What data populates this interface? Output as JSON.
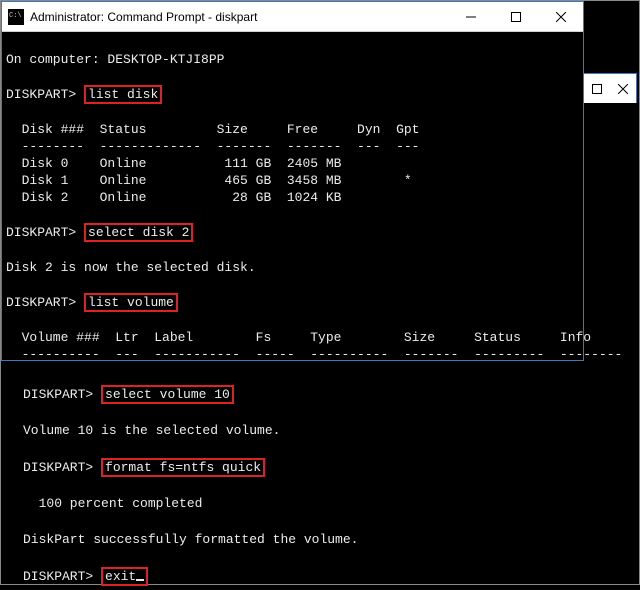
{
  "front": {
    "title": "Administrator: Command Prompt - diskpart",
    "computer_line": "On computer: DESKTOP-KTJI8PP",
    "prompt": "DISKPART>",
    "cmd_list_disk": "list disk",
    "disk_header": "  Disk ###  Status         Size     Free     Dyn  Gpt",
    "disk_divider": "  --------  -------------  -------  -------  ---  ---",
    "disk_rows": [
      "  Disk 0    Online          111 GB  2405 MB",
      "  Disk 1    Online          465 GB  3458 MB        *",
      "  Disk 2    Online           28 GB  1024 KB"
    ],
    "cmd_select_disk": "select disk 2",
    "selected_disk_msg": "Disk 2 is now the selected disk.",
    "cmd_list_volume": "list volume",
    "vol_header": "  Volume ###  Ltr  Label        Fs     Type        Size     Status     Info",
    "vol_divider": "  ----------  ---  -----------  -----  ----------  -------  ---------  --------"
  },
  "lower": {
    "prompt": "DISKPART>",
    "cmd_select_volume": "select volume 10",
    "selected_vol_msg": "Volume 10 is the selected volume.",
    "cmd_format": "format fs=ntfs quick",
    "progress_msg": "  100 percent completed",
    "success_msg": "DiskPart successfully formatted the volume.",
    "cmd_exit": "exit"
  },
  "chart_data": {
    "type": "table",
    "title": "diskpart list disk",
    "columns": [
      "Disk ###",
      "Status",
      "Size",
      "Free",
      "Dyn",
      "Gpt"
    ],
    "rows": [
      [
        "Disk 0",
        "Online",
        "111 GB",
        "2405 MB",
        "",
        ""
      ],
      [
        "Disk 1",
        "Online",
        "465 GB",
        "3458 MB",
        "",
        "*"
      ],
      [
        "Disk 2",
        "Online",
        "28 GB",
        "1024 KB",
        "",
        ""
      ]
    ]
  }
}
